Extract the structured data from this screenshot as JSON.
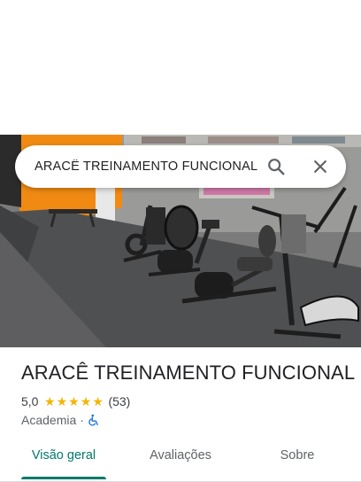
{
  "search": {
    "query": "ARACÊ TREINAMENTO FUNCIONAL",
    "search_icon": "search-icon",
    "close_icon": "close-icon"
  },
  "place": {
    "name": "ARACÊ TREINAMENTO FUNCIONAL",
    "rating": "5,0",
    "stars": 5,
    "review_count": "(53)",
    "category": "Academia",
    "separator": "·",
    "accessibility_icon": "wheelchair-icon"
  },
  "tabs": [
    {
      "label": "Visão geral",
      "selected": true
    },
    {
      "label": "Avaliações",
      "selected": false
    },
    {
      "label": "Sobre",
      "selected": false
    }
  ],
  "colors": {
    "accent": "#00796b",
    "star": "#f4b400",
    "accessibility": "#1a73e8"
  }
}
